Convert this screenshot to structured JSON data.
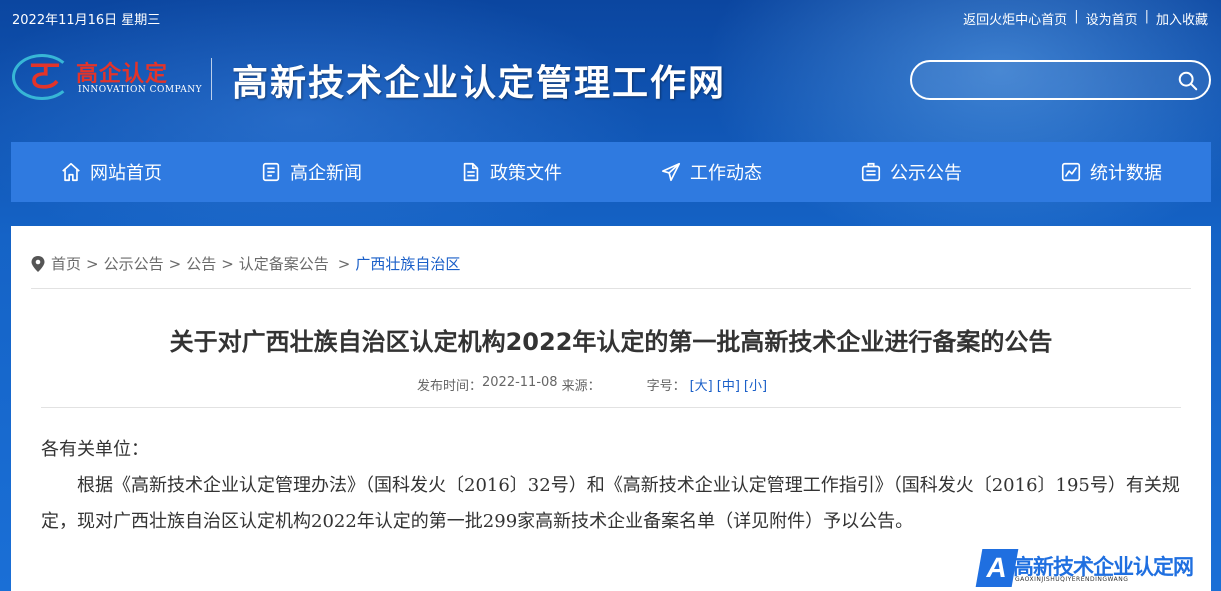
{
  "topbar": {
    "date": "2022年11月16日 星期三",
    "links": [
      "返回火炬中心首页",
      "设为首页",
      "加入收藏"
    ],
    "separator": "|"
  },
  "logo": {
    "cn": "高企认定",
    "en": "INNOVATION COMPANY"
  },
  "site_title": "高新技术企业认定管理工作网",
  "search": {
    "value": "",
    "icon": "search-icon"
  },
  "nav": [
    {
      "label": "网站首页",
      "icon": "home-icon"
    },
    {
      "label": "高企新闻",
      "icon": "news-icon"
    },
    {
      "label": "政策文件",
      "icon": "document-icon"
    },
    {
      "label": "工作动态",
      "icon": "paper-plane-icon"
    },
    {
      "label": "公示公告",
      "icon": "notice-icon"
    },
    {
      "label": "统计数据",
      "icon": "chart-icon"
    }
  ],
  "breadcrumb": {
    "items": [
      "首页",
      "公示公告",
      "公告",
      "认定备案公告",
      "广西壮族自治区"
    ],
    "separator": ">"
  },
  "article": {
    "title": "关于对广西壮族自治区认定机构2022年认定的第一批高新技术企业进行备案的公告",
    "meta": {
      "published_label": "发布时间：",
      "published": "2022-11-08",
      "source_label": "来源：",
      "fontsize_label": "字号：",
      "sizes": [
        "[大]",
        "[中]",
        "[小]"
      ]
    },
    "greeting": "各有关单位：",
    "paragraph": "根据《高新技术企业认定管理办法》（国科发火〔2016〕32号）和《高新技术企业认定管理工作指引》（国科发火〔2016〕195号）有关规定，现对广西壮族自治区认定机构2022年认定的第一批299家高新技术企业备案名单（详见附件）予以公告。"
  },
  "watermark": {
    "badge": "A",
    "cn": "高新技术企业认定网",
    "en": "GAOXINJISHUQIYERENDINGWANG"
  },
  "colors": {
    "nav_bg": "#2f7ae0",
    "link_blue": "#1a5fc8",
    "logo_red": "#e3342a"
  }
}
